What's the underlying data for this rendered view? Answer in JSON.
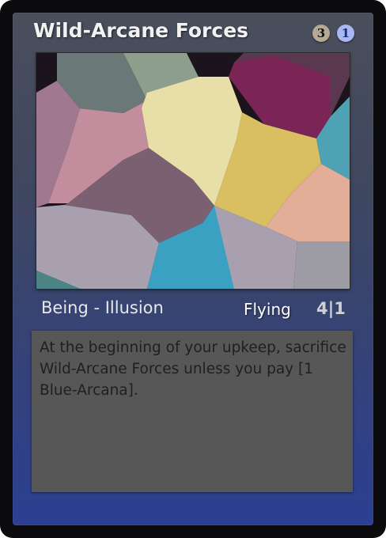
{
  "card": {
    "name": "Wild-Arcane Forces",
    "mana_cost": [
      {
        "symbol": "3",
        "color": "#b6aa95"
      },
      {
        "symbol": "1",
        "color": "#a9b8f0"
      }
    ],
    "type_line": "Being - Illusion",
    "keyword": "Flying",
    "power_toughness": "4|1",
    "rules_text": "At the beginning of your upkeep, sacrifice Wild-Arcane Forces unless you pay [1 Blue-Arcana].",
    "frame_color": "#34427a",
    "art_palette": [
      "#6a7878",
      "#8d9e8c",
      "#7b2556",
      "#5a3850",
      "#a07890",
      "#e8dfa8",
      "#c28e9e",
      "#7a6070",
      "#d9bf62",
      "#e3ae98",
      "#4ea2b4",
      "#a8a0ae",
      "#3ba1c2",
      "#9d9ba4",
      "#4c8385"
    ]
  }
}
